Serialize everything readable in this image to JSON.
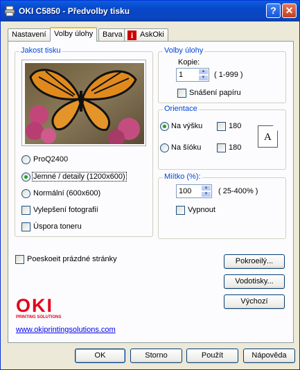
{
  "window": {
    "title": "OKI C5850 - Předvolby tisku",
    "help_glyph": "?",
    "close_glyph": "✕"
  },
  "tabs": [
    {
      "label": "Nastavení"
    },
    {
      "label": "Volby úlohy"
    },
    {
      "label": "Barva"
    },
    {
      "label": "AskOki"
    }
  ],
  "quality": {
    "legend": "Jakost tisku",
    "options": [
      {
        "label": "ProQ2400",
        "selected": false
      },
      {
        "label": "Jemné / detaily (1200x600)",
        "selected": true
      },
      {
        "label": "Normální (600x600)",
        "selected": false
      }
    ],
    "photo_enhance": {
      "label": "Vylepšení fotografií",
      "checked": false
    },
    "toner_save": {
      "label": "Úspora toneru",
      "checked": false
    }
  },
  "job": {
    "legend": "Volby úlohy",
    "copies_label": "Kopie:",
    "copies_value": "1",
    "copies_range": "( 1-999 )",
    "collate": {
      "label": "Snášení papíru",
      "checked": false
    }
  },
  "orientation": {
    "legend": "Orientace",
    "portrait": {
      "label": "Na výšku",
      "selected": true
    },
    "landscape": {
      "label": "Na šíóku",
      "selected": false
    },
    "rotate1": {
      "label": "180",
      "checked": false
    },
    "rotate2": {
      "label": "180",
      "checked": false
    },
    "preview_letter": "A"
  },
  "scale": {
    "legend": "Mi­ítko (%):",
    "value": "100",
    "range": "( 25-400% )",
    "off": {
      "label": "Vypnout",
      "checked": false
    }
  },
  "skip_blank": {
    "label": "Poeskoeit prázdné stránky",
    "checked": false
  },
  "side_buttons": {
    "advanced": "Pokroeilý...",
    "watermarks": "Vodotisky...",
    "default": "Výchozí"
  },
  "brand": {
    "logo": "OKI",
    "tagline": "PRINTING SOLUTIONS",
    "url": "www.okiprintingsolutions.com",
    "color": "#e2001a"
  },
  "footer": {
    "ok": "OK",
    "cancel": "Storno",
    "apply": "Použít",
    "help": "Nápověda"
  }
}
